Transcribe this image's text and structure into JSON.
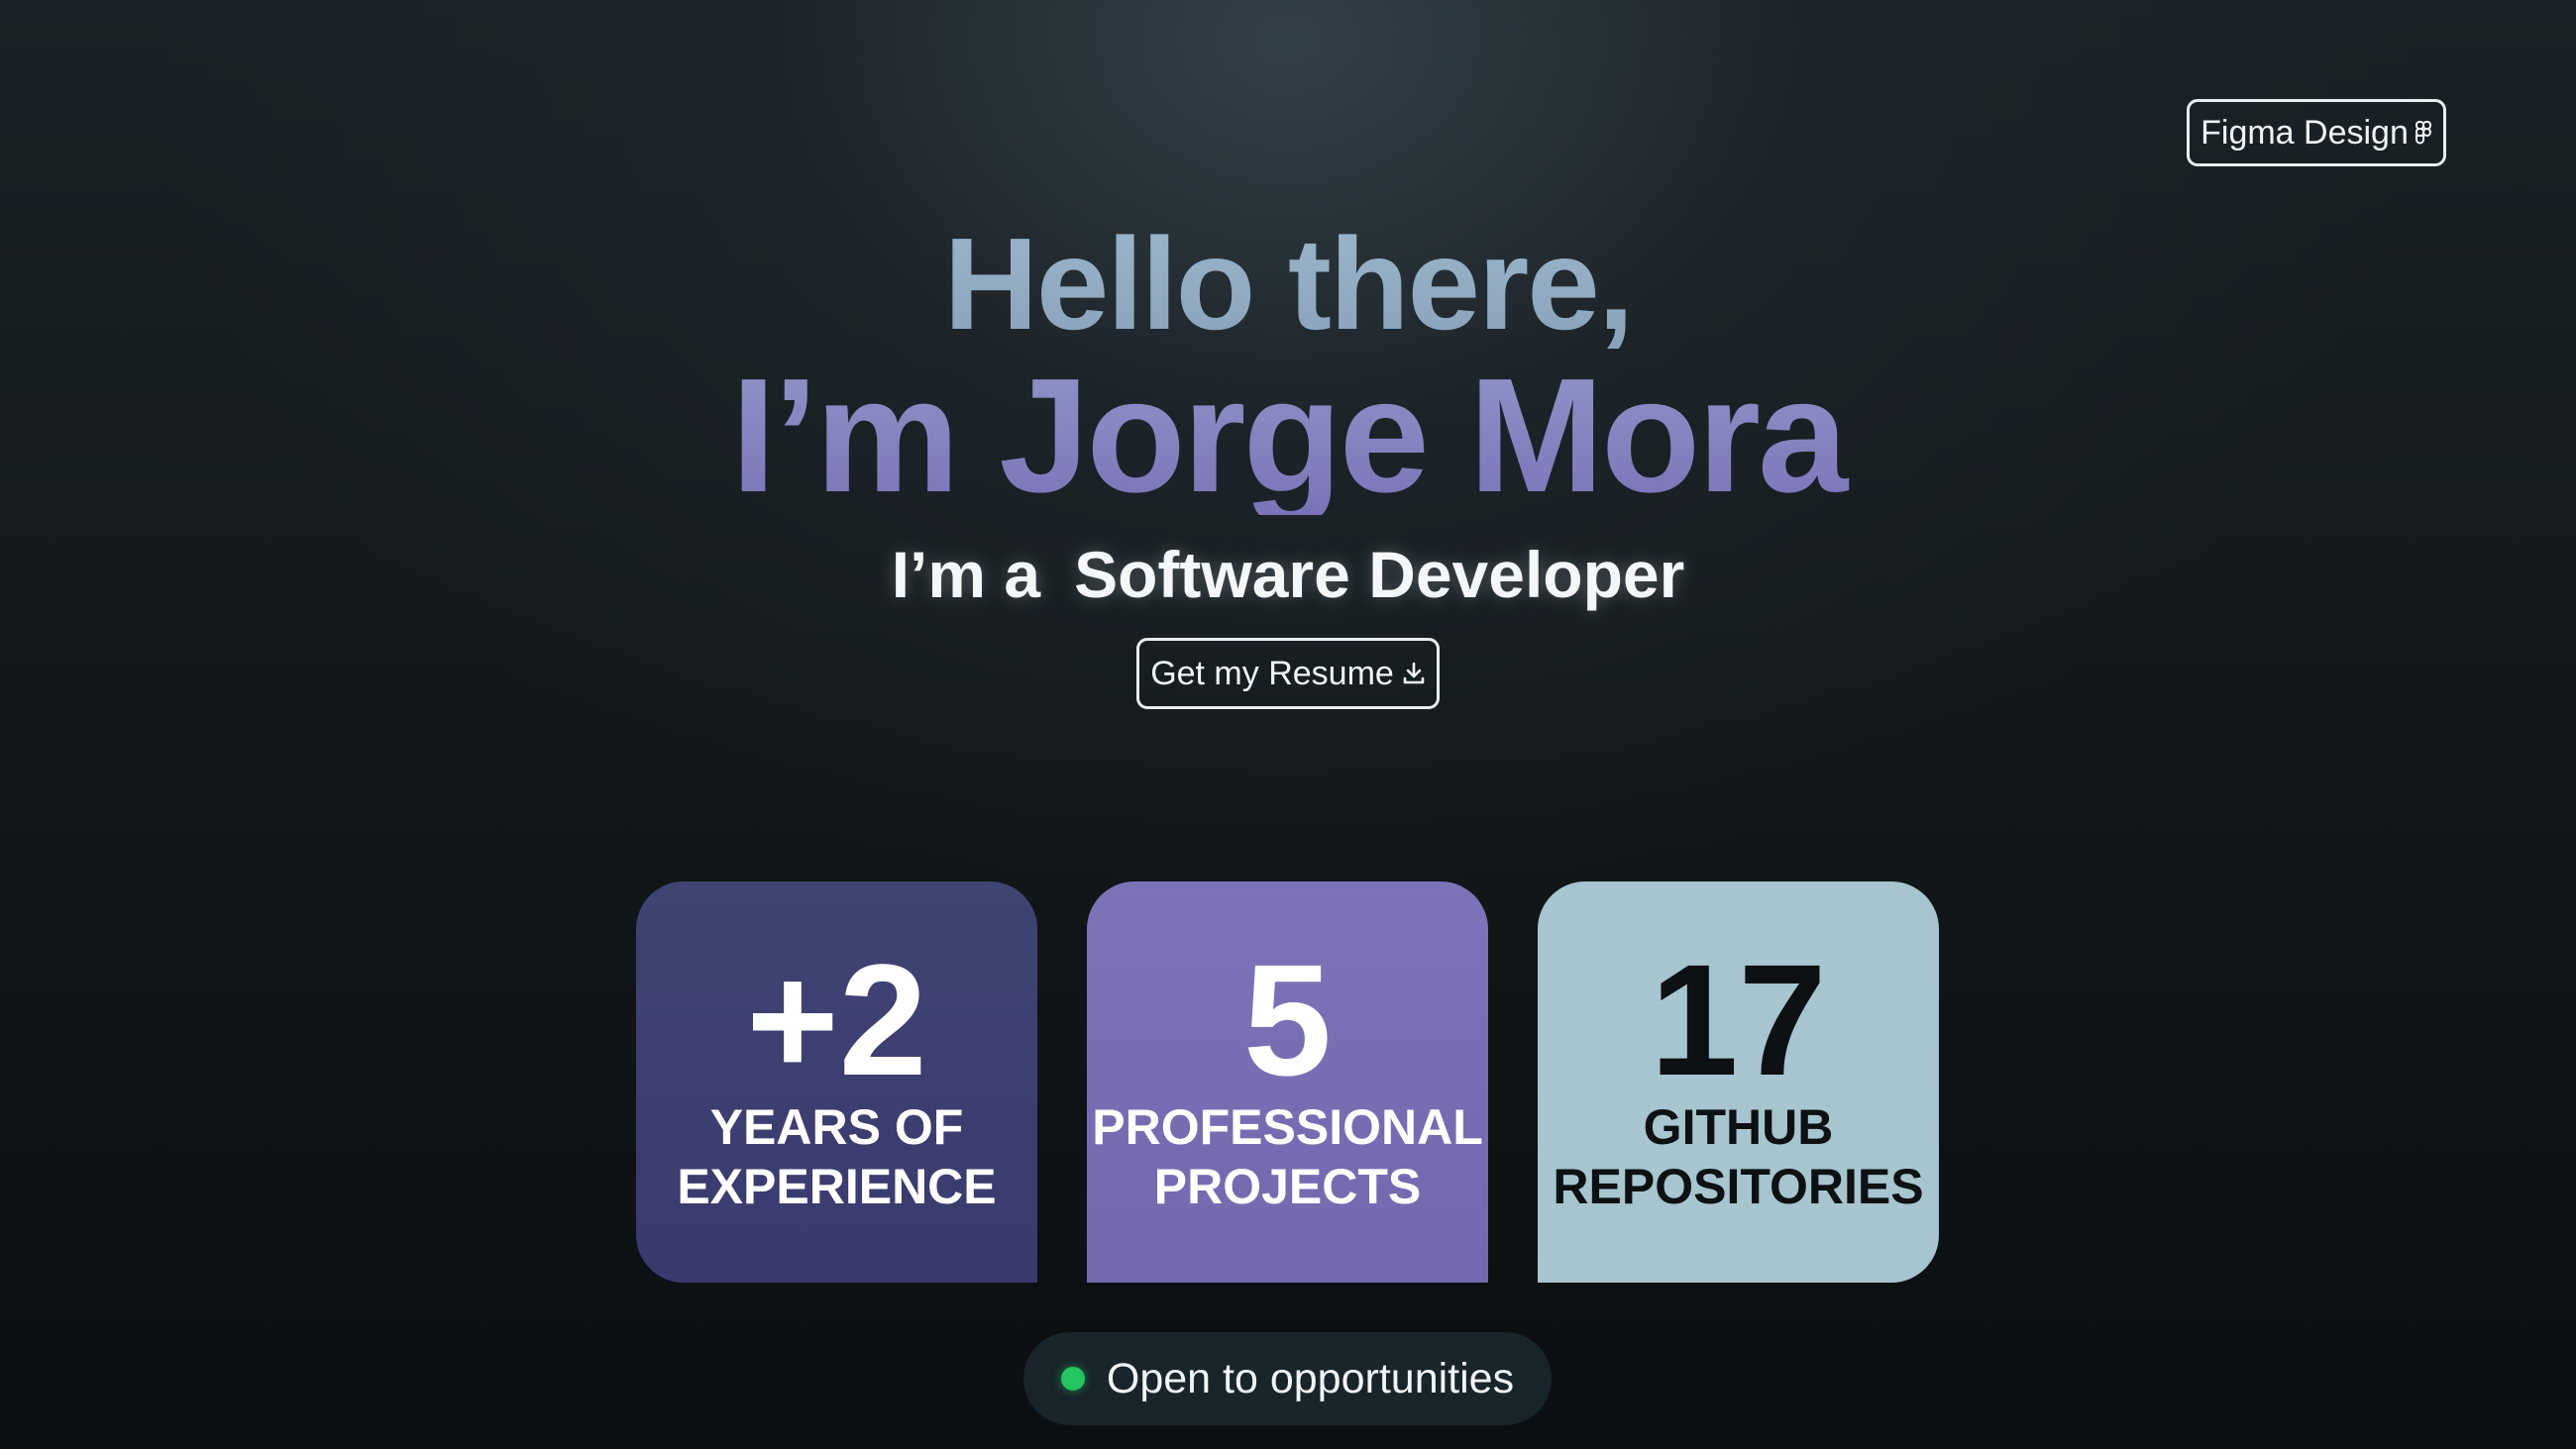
{
  "header": {
    "figma_label": "Figma Design",
    "figma_icon": "figma-icon"
  },
  "hero": {
    "greeting": "Hello there,",
    "name": "I’m Jorge Mora",
    "role_prefix": "I’m a",
    "role": "Software Developer"
  },
  "resume": {
    "label": "Get my Resume",
    "icon": "download-icon"
  },
  "stats": [
    {
      "value": "+2",
      "label_line1": "YEARS OF",
      "label_line2": "EXPERIENCE",
      "color": "#3d406f"
    },
    {
      "value": "5",
      "label_line1": "PROFESSIONAL",
      "label_line2": "PROJECTS",
      "color": "#786eb4"
    },
    {
      "value": "17",
      "label_line1": "GITHUB",
      "label_line2": "REPOSITORIES",
      "color": "#a7c5cf"
    }
  ],
  "status": {
    "label": "Open to opportunities",
    "indicator_color": "#22c55e"
  },
  "colors": {
    "background": "#0f1417",
    "greeting": "#92adc4",
    "name": "#8580bd"
  }
}
